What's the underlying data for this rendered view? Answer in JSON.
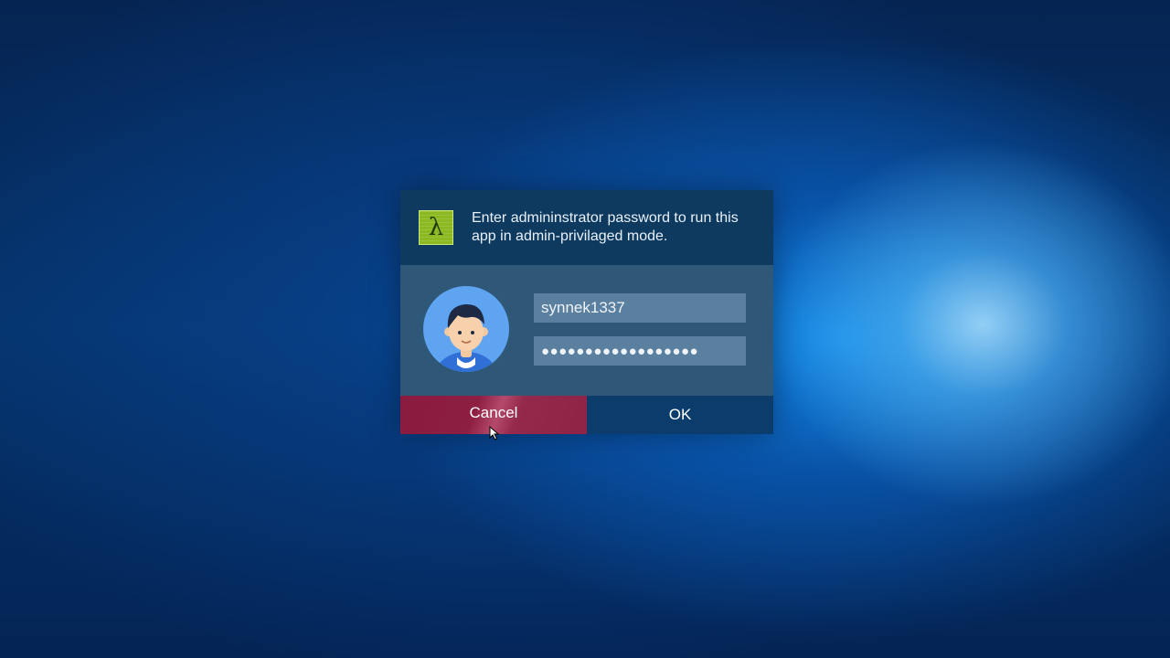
{
  "dialog": {
    "message": "Enter admininstrator password to run this app in admin-privilaged mode.",
    "app_icon": {
      "name": "lambda-app-icon",
      "glyph": "λ",
      "color": "#8cb821"
    },
    "username": "synnek1337",
    "password_mask": "●●●●●●●●●●●●●●●●●●",
    "avatar": "user-avatar-icon",
    "buttons": {
      "cancel": "Cancel",
      "ok": "OK"
    }
  },
  "colors": {
    "header_bg": "#0f3a60",
    "body_bg": "#2f5878",
    "field_bg": "#5b7f9e",
    "cancel_bg": "#8a1b3e",
    "ok_bg": "#0b3c6c",
    "avatar_bg": "#5ea4f0"
  }
}
